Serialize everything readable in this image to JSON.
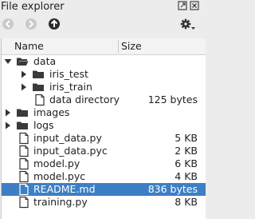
{
  "window": {
    "title": "File explorer"
  },
  "tree": {
    "columns": {
      "name": "Name",
      "size": "Size"
    },
    "rows": [
      {
        "name": "data",
        "size": "",
        "type": "folder",
        "expanded": true,
        "depth": 0
      },
      {
        "name": "iris_test",
        "size": "",
        "type": "folder",
        "expanded": false,
        "depth": 1
      },
      {
        "name": "iris_train",
        "size": "",
        "type": "folder",
        "expanded": false,
        "depth": 1
      },
      {
        "name": "data directory",
        "size": "125 bytes",
        "type": "file",
        "depth": 1
      },
      {
        "name": "images",
        "size": "",
        "type": "folder",
        "expanded": false,
        "depth": 0
      },
      {
        "name": "logs",
        "size": "",
        "type": "folder",
        "expanded": false,
        "depth": 0
      },
      {
        "name": "input_data.py",
        "size": "5 KB",
        "type": "file",
        "depth": 0
      },
      {
        "name": "input_data.pyc",
        "size": "2 KB",
        "type": "file",
        "depth": 0
      },
      {
        "name": "model.py",
        "size": "6 KB",
        "type": "file",
        "depth": 0
      },
      {
        "name": "model.pyc",
        "size": "4 KB",
        "type": "file",
        "depth": 0
      },
      {
        "name": "README.md",
        "size": "836 bytes",
        "type": "file",
        "depth": 0,
        "selected": true
      },
      {
        "name": "training.py",
        "size": "8 KB",
        "type": "file",
        "depth": 0
      }
    ]
  },
  "colors": {
    "selection": "#3d7fc4",
    "folder": "#3a3a3a"
  }
}
